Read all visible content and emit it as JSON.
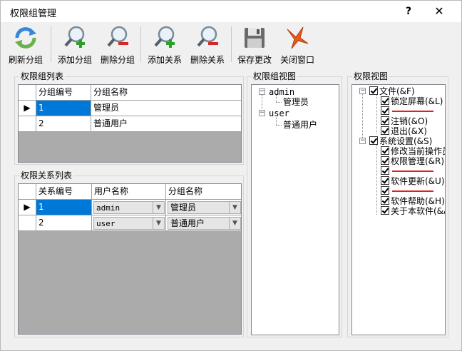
{
  "window": {
    "title": "权限组管理",
    "help": "?",
    "close": "✕"
  },
  "toolbar": [
    {
      "label": "刷新分组",
      "icon": "refresh-icon"
    },
    {
      "label": "添加分组",
      "icon": "add-icon"
    },
    {
      "label": "删除分组",
      "icon": "remove-icon"
    },
    {
      "label": "添加关系",
      "icon": "add-icon"
    },
    {
      "label": "删除关系",
      "icon": "remove-icon"
    },
    {
      "label": "保存更改",
      "icon": "save-icon"
    },
    {
      "label": "关闭窗口",
      "icon": "close-window-icon"
    }
  ],
  "group_list": {
    "title": "权限组列表",
    "headers": [
      "分组编号",
      "分组名称"
    ],
    "rows": [
      {
        "id": "1",
        "name": "管理员"
      },
      {
        "id": "2",
        "name": "普通用户"
      }
    ]
  },
  "relation_list": {
    "title": "权限关系列表",
    "headers": [
      "关系编号",
      "用户名称",
      "分组名称"
    ],
    "rows": [
      {
        "id": "1",
        "user": "admin",
        "group": "管理员"
      },
      {
        "id": "2",
        "user": "user",
        "group": "普通用户"
      }
    ]
  },
  "group_view": {
    "title": "权限组视图",
    "nodes": [
      {
        "label": "admin",
        "children": [
          "管理员"
        ]
      },
      {
        "label": "user",
        "children": [
          "普通用户"
        ]
      }
    ]
  },
  "perm_view": {
    "title": "权限视图",
    "nodes": [
      {
        "label": "文件(&F)",
        "children": [
          "锁定屏幕(&L)",
          "",
          "注销(&O)",
          "退出(&X)"
        ]
      },
      {
        "label": "系统设置(&S)",
        "children": [
          "修改当前操作员",
          "权限管理(&R)",
          "",
          "软件更新(&U)",
          "",
          "软件帮助(&H)",
          "关于本软件(&A)"
        ]
      }
    ]
  },
  "colors": {
    "selection": "#0078d7",
    "separator": "#e02020",
    "window_bg": "#f0f0f0"
  }
}
